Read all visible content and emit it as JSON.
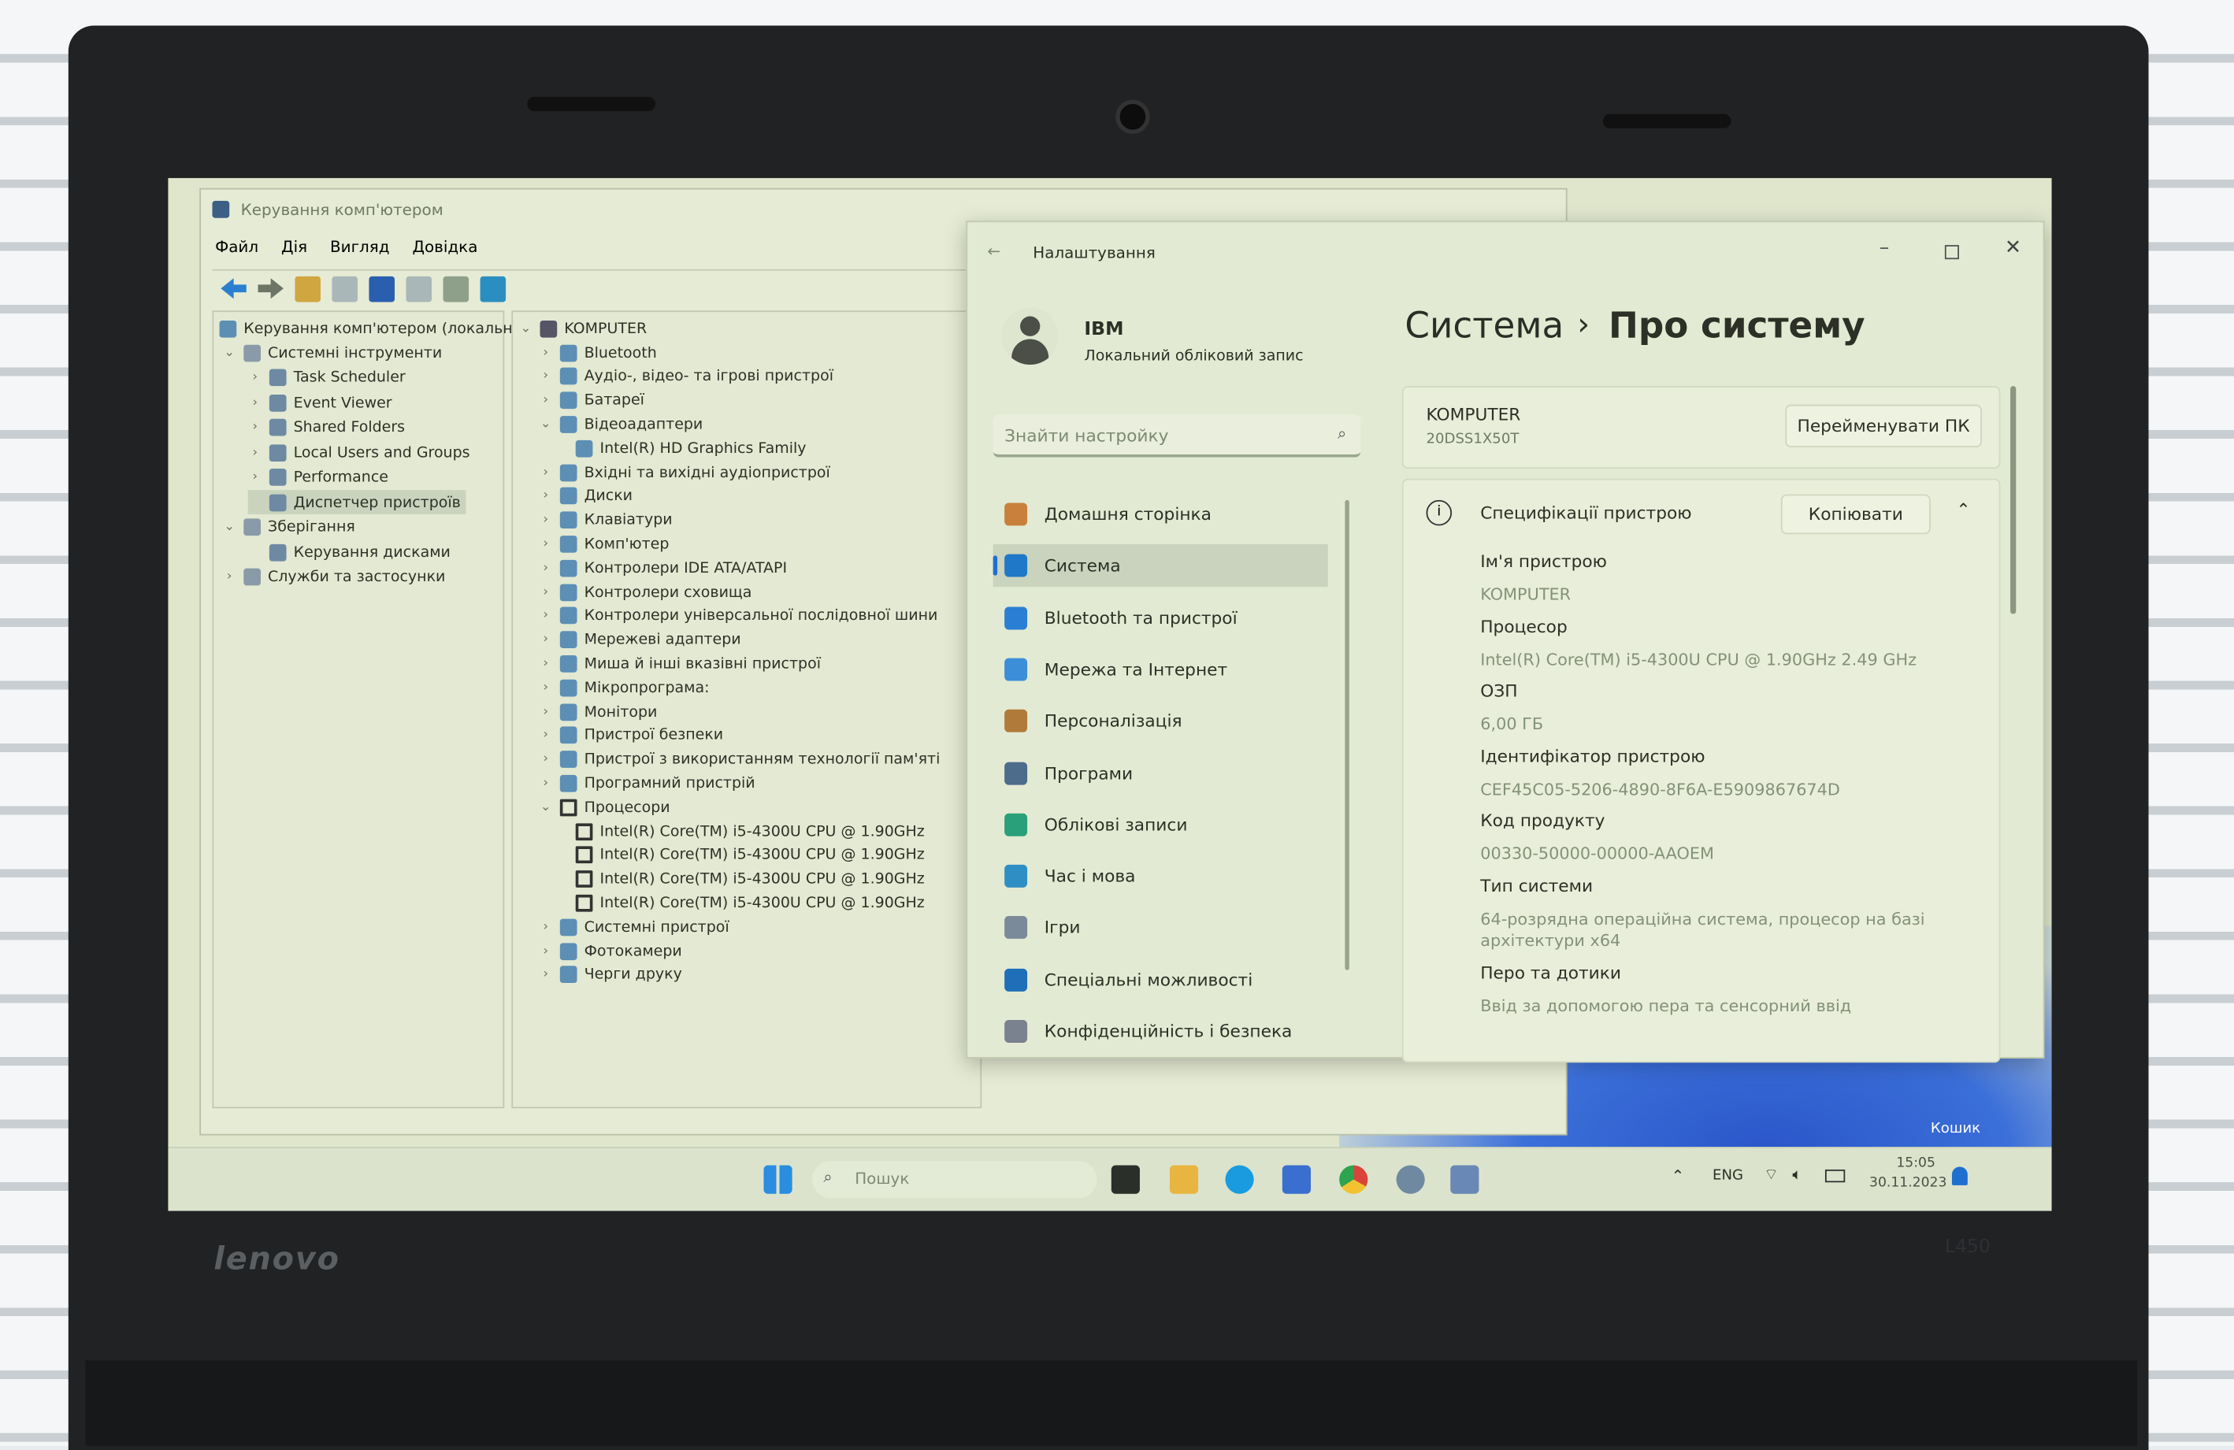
{
  "computer_management": {
    "title": "Керування комп'ютером",
    "menu": [
      "Файл",
      "Дія",
      "Вигляд",
      "Довідка"
    ],
    "tree": {
      "root": "Керування комп'ютером (локальний)",
      "items": [
        {
          "label": "Системні інструменти",
          "level": 1,
          "expanded": true
        },
        {
          "label": "Task Scheduler",
          "level": 2
        },
        {
          "label": "Event Viewer",
          "level": 2
        },
        {
          "label": "Shared Folders",
          "level": 2
        },
        {
          "label": "Local Users and Groups",
          "level": 2
        },
        {
          "label": "Performance",
          "level": 2
        },
        {
          "label": "Диспетчер пристроїв",
          "level": 2,
          "selected": true
        },
        {
          "label": "Зберігання",
          "level": 1,
          "expanded": true
        },
        {
          "label": "Керування дисками",
          "level": 2
        },
        {
          "label": "Служби та застосунки",
          "level": 1
        }
      ]
    },
    "devices": {
      "root": "KOMPUTER",
      "items": [
        {
          "label": "Bluetooth",
          "level": 1
        },
        {
          "label": "Аудіо-, відео- та ігрові пристрої",
          "level": 1
        },
        {
          "label": "Батареї",
          "level": 1
        },
        {
          "label": "Відеоадаптери",
          "level": 1,
          "expanded": true
        },
        {
          "label": "Intel(R) HD Graphics Family",
          "level": 2
        },
        {
          "label": "Вхідні та вихідні аудіопристрої",
          "level": 1
        },
        {
          "label": "Диски",
          "level": 1
        },
        {
          "label": "Клавіатури",
          "level": 1
        },
        {
          "label": "Комп'ютер",
          "level": 1
        },
        {
          "label": "Контролери IDE ATA/ATAPI",
          "level": 1
        },
        {
          "label": "Контролери сховища",
          "level": 1
        },
        {
          "label": "Контролери універсальної послідовної шини",
          "level": 1
        },
        {
          "label": "Мережеві адаптери",
          "level": 1
        },
        {
          "label": "Миша й інші вказівні пристрої",
          "level": 1
        },
        {
          "label": "Мікропрограма:",
          "level": 1
        },
        {
          "label": "Монітори",
          "level": 1
        },
        {
          "label": "Пристрої безпеки",
          "level": 1
        },
        {
          "label": "Пристрої з використанням технології пам'яті",
          "level": 1
        },
        {
          "label": "Програмний пристрій",
          "level": 1
        },
        {
          "label": "Процесори",
          "level": 1,
          "expanded": true
        },
        {
          "label": "Intel(R) Core(TM) i5-4300U CPU @ 1.90GHz",
          "level": 2
        },
        {
          "label": "Intel(R) Core(TM) i5-4300U CPU @ 1.90GHz",
          "level": 2
        },
        {
          "label": "Intel(R) Core(TM) i5-4300U CPU @ 1.90GHz",
          "level": 2
        },
        {
          "label": "Intel(R) Core(TM) i5-4300U CPU @ 1.90GHz",
          "level": 2
        },
        {
          "label": "Системні пристрої",
          "level": 1
        },
        {
          "label": "Фотокамери",
          "level": 1
        },
        {
          "label": "Черги друку",
          "level": 1
        }
      ]
    }
  },
  "settings": {
    "title": "Налаштування",
    "user": {
      "name": "IBM",
      "account": "Локальний обліковий запис"
    },
    "search_placeholder": "Знайти настройку",
    "breadcrumb": {
      "parent": "Система",
      "separator": "›",
      "current": "Про систему"
    },
    "nav": [
      {
        "label": "Домашня сторінка",
        "icon": "home-icon",
        "color": "#c9803c"
      },
      {
        "label": "Система",
        "icon": "system-icon",
        "color": "#1f78c8",
        "selected": true
      },
      {
        "label": "Bluetooth та пристрої",
        "icon": "bluetooth-icon",
        "color": "#2a7fd4"
      },
      {
        "label": "Мережа та Інтернет",
        "icon": "network-icon",
        "color": "#3d8ed8"
      },
      {
        "label": "Персоналізація",
        "icon": "brush-icon",
        "color": "#b07a3a"
      },
      {
        "label": "Програми",
        "icon": "apps-icon",
        "color": "#4d6b8a"
      },
      {
        "label": "Облікові записи",
        "icon": "accounts-icon",
        "color": "#2aa07a"
      },
      {
        "label": "Час і мова",
        "icon": "time-language-icon",
        "color": "#2f8fc4"
      },
      {
        "label": "Ігри",
        "icon": "gaming-icon",
        "color": "#7a8a9a"
      },
      {
        "label": "Спеціальні можливості",
        "icon": "accessibility-icon",
        "color": "#1f6fb8"
      },
      {
        "label": "Конфіденційність і безпека",
        "icon": "shield-icon",
        "color": "#7a8290"
      }
    ],
    "device": {
      "name": "KOMPUTER",
      "model": "20DSS1X50T",
      "rename_button": "Перейменувати ПК"
    },
    "specs": {
      "title": "Специфікації пристрою",
      "copy_button": "Копіювати",
      "items": [
        {
          "label": "Ім'я пристрою",
          "value": "KOMPUTER"
        },
        {
          "label": "Процесор",
          "value": "Intel(R) Core(TM) i5-4300U CPU @ 1.90GHz   2.49 GHz"
        },
        {
          "label": "ОЗП",
          "value": "6,00 ГБ"
        },
        {
          "label": "Ідентифікатор пристрою",
          "value": "CEF45C05-5206-4890-8F6A-E5909867674D"
        },
        {
          "label": "Код продукту",
          "value": "00330-50000-00000-AAOEM"
        },
        {
          "label": "Тип системи",
          "value": "64-розрядна операційна система, процесор на базі архітектури x64"
        },
        {
          "label": "Перо та дотики",
          "value": "Ввід за допомогою пера та сенсорний ввід"
        }
      ]
    }
  },
  "desktop": {
    "recycle_bin": "Кошик"
  },
  "taskbar": {
    "search_placeholder": "Пошук",
    "language": "ENG",
    "time": "15:05",
    "date": "30.11.2023"
  },
  "laptop": {
    "brand": "lenovo",
    "model": "L450"
  }
}
